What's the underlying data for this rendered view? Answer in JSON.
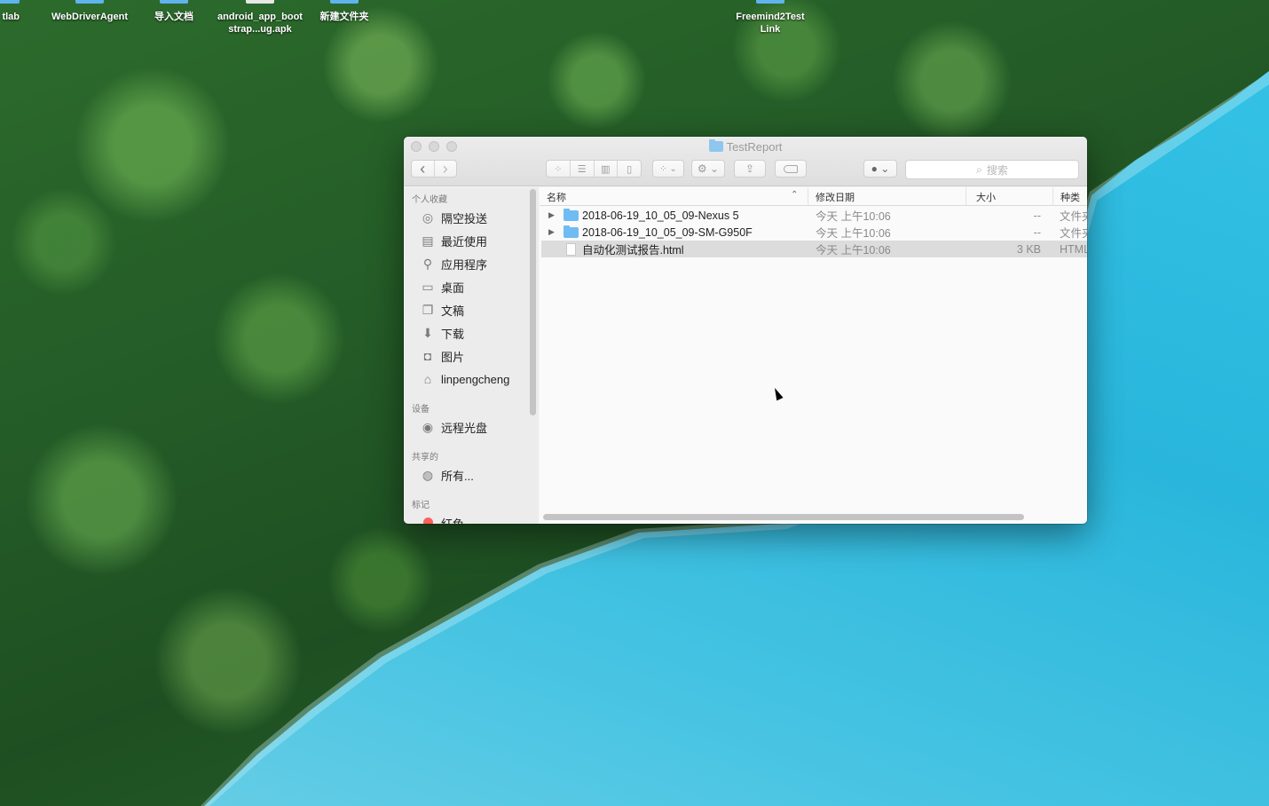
{
  "desktop": {
    "icons": [
      {
        "label": "tlab"
      },
      {
        "label": "WebDriverAgent"
      },
      {
        "label": "导入文档"
      },
      {
        "label": "android_app_bootstrap...ug.apk"
      },
      {
        "label": "新建文件夹"
      },
      {
        "label": "Freemind2Test Link"
      }
    ]
  },
  "window": {
    "title": "TestReport",
    "toolbar": {
      "back": "‹",
      "forward": "›",
      "search_placeholder": "搜索"
    },
    "sidebar": {
      "sections": [
        {
          "header": "个人收藏",
          "items": [
            {
              "icon": "airdrop-icon",
              "glyph": "◎",
              "label": "隔空投送"
            },
            {
              "icon": "recents-icon",
              "glyph": "▤",
              "label": "最近使用"
            },
            {
              "icon": "applications-icon",
              "glyph": "⚲",
              "label": "应用程序"
            },
            {
              "icon": "desktop-icon",
              "glyph": "▭",
              "label": "桌面"
            },
            {
              "icon": "documents-icon",
              "glyph": "❐",
              "label": "文稿"
            },
            {
              "icon": "downloads-icon",
              "glyph": "⬇",
              "label": "下载"
            },
            {
              "icon": "pictures-icon",
              "glyph": "◘",
              "label": "图片"
            },
            {
              "icon": "home-icon",
              "glyph": "⌂",
              "label": "linpengcheng"
            }
          ]
        },
        {
          "header": "设备",
          "items": [
            {
              "icon": "remote-disc-icon",
              "glyph": "◉",
              "label": "远程光盘"
            }
          ]
        },
        {
          "header": "共享的",
          "items": [
            {
              "icon": "network-icon",
              "glyph": "◍",
              "label": "所有..."
            }
          ]
        },
        {
          "header": "标记",
          "items": [
            {
              "icon": "red-tag-icon",
              "glyph": "",
              "label": "红色"
            }
          ]
        }
      ]
    },
    "columns": {
      "name": "名称",
      "date": "修改日期",
      "size": "大小",
      "kind": "种类"
    },
    "rows": [
      {
        "type": "folder",
        "name": "2018-06-19_10_05_09-Nexus 5",
        "date": "今天 上午10:06",
        "size": "--",
        "kind": "文件夹"
      },
      {
        "type": "folder",
        "name": "2018-06-19_10_05_09-SM-G950F",
        "date": "今天 上午10:06",
        "size": "--",
        "kind": "文件夹"
      },
      {
        "type": "file",
        "name": "自动化测试报告.html",
        "date": "今天 上午10:06",
        "size": "3 KB",
        "kind": "HTML"
      }
    ]
  },
  "colors": {
    "folder": "#6fbcf3",
    "lake": "#29b6dc",
    "forest": "#245c27",
    "tag_red": "#fc605b"
  }
}
